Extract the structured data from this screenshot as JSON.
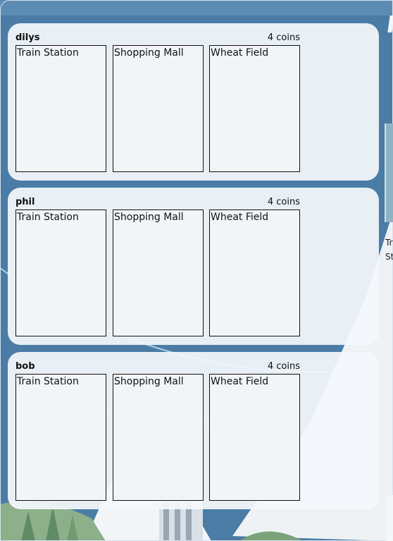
{
  "players": [
    {
      "name": "dilys",
      "coins": "4 coins",
      "cards": [
        {
          "name": "Train Station"
        },
        {
          "name": "Shopping Mall"
        },
        {
          "name": "Wheat Field"
        }
      ]
    },
    {
      "name": "phil",
      "coins": "4 coins",
      "cards": [
        {
          "name": "Train Station"
        },
        {
          "name": "Shopping Mall"
        },
        {
          "name": "Wheat Field"
        }
      ]
    },
    {
      "name": "bob",
      "coins": "4 coins",
      "cards": [
        {
          "name": "Train Station"
        },
        {
          "name": "Shopping Mall"
        },
        {
          "name": "Wheat Field"
        }
      ]
    }
  ],
  "side_card_text": [
    "Tr",
    "St"
  ]
}
